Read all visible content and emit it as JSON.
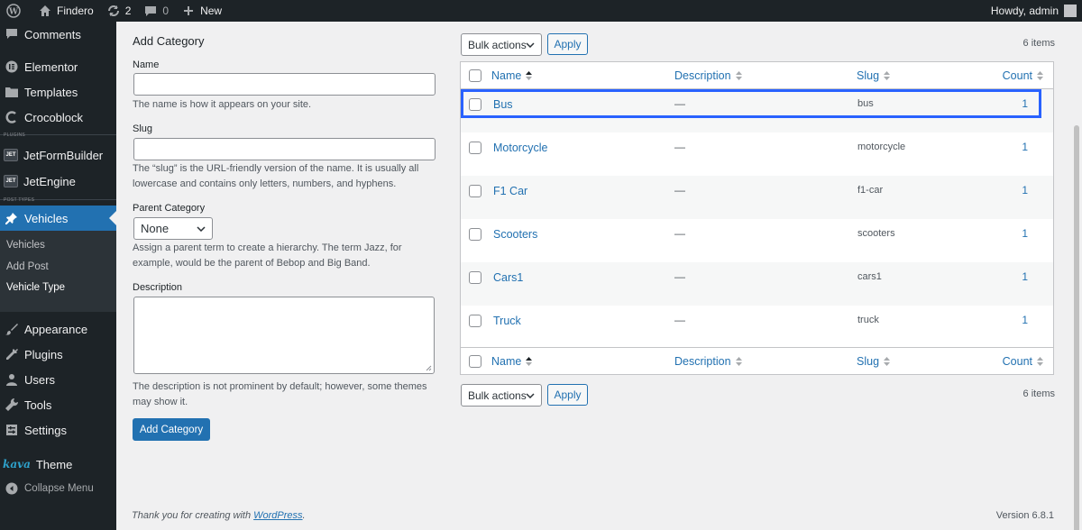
{
  "adminbar": {
    "site_name": "Findero",
    "updates_count": "2",
    "comments_count": "0",
    "new_label": "New",
    "howdy": "Howdy, admin"
  },
  "sidebar": {
    "comments": "Comments",
    "elementor": "Elementor",
    "templates": "Templates",
    "crocoblock": "Crocoblock",
    "plugins_sep": "PLUGINS",
    "jetformbuilder": "JetFormBuilder",
    "jetengine": "JetEngine",
    "post_types_sep": "POST TYPES",
    "vehicles": "Vehicles",
    "sub_vehicles": "Vehicles",
    "sub_add_post": "Add Post",
    "sub_vehicle_type": "Vehicle Type",
    "appearance": "Appearance",
    "plugins": "Plugins",
    "users": "Users",
    "tools": "Tools",
    "settings": "Settings",
    "kava_logo": "kava",
    "theme": "Theme",
    "collapse": "Collapse Menu"
  },
  "form": {
    "heading": "Add Category",
    "name_label": "Name",
    "name_value": "",
    "name_desc": "The name is how it appears on your site.",
    "slug_label": "Slug",
    "slug_value": "",
    "slug_desc": "The “slug” is the URL-friendly version of the name. It is usually all lowercase and contains only letters, numbers, and hyphens.",
    "parent_label": "Parent Category",
    "parent_value": "None",
    "parent_desc": "Assign a parent term to create a hierarchy. The term Jazz, for example, would be the parent of Bebop and Big Band.",
    "description_label": "Description",
    "description_value": "",
    "description_desc": "The description is not prominent by default; however, some themes may show it.",
    "submit": "Add Category"
  },
  "table": {
    "bulk_actions": "Bulk actions",
    "apply": "Apply",
    "items_count": "6 items",
    "columns": {
      "name": "Name",
      "description": "Description",
      "slug": "Slug",
      "count": "Count"
    },
    "rows": [
      {
        "name": "Bus",
        "description": "—",
        "slug": "bus",
        "count": "1"
      },
      {
        "name": "Motorcycle",
        "description": "—",
        "slug": "motorcycle",
        "count": "1"
      },
      {
        "name": "F1 Car",
        "description": "—",
        "slug": "f1-car",
        "count": "1"
      },
      {
        "name": "Scooters",
        "description": "—",
        "slug": "scooters",
        "count": "1"
      },
      {
        "name": "Cars1",
        "description": "—",
        "slug": "cars1",
        "count": "1"
      },
      {
        "name": "Truck",
        "description": "—",
        "slug": "truck",
        "count": "1"
      }
    ]
  },
  "footer": {
    "thanks_prefix": "Thank you for creating with ",
    "wordpress_link": "WordPress",
    "thanks_suffix": ".",
    "version": "Version 6.8.1"
  }
}
